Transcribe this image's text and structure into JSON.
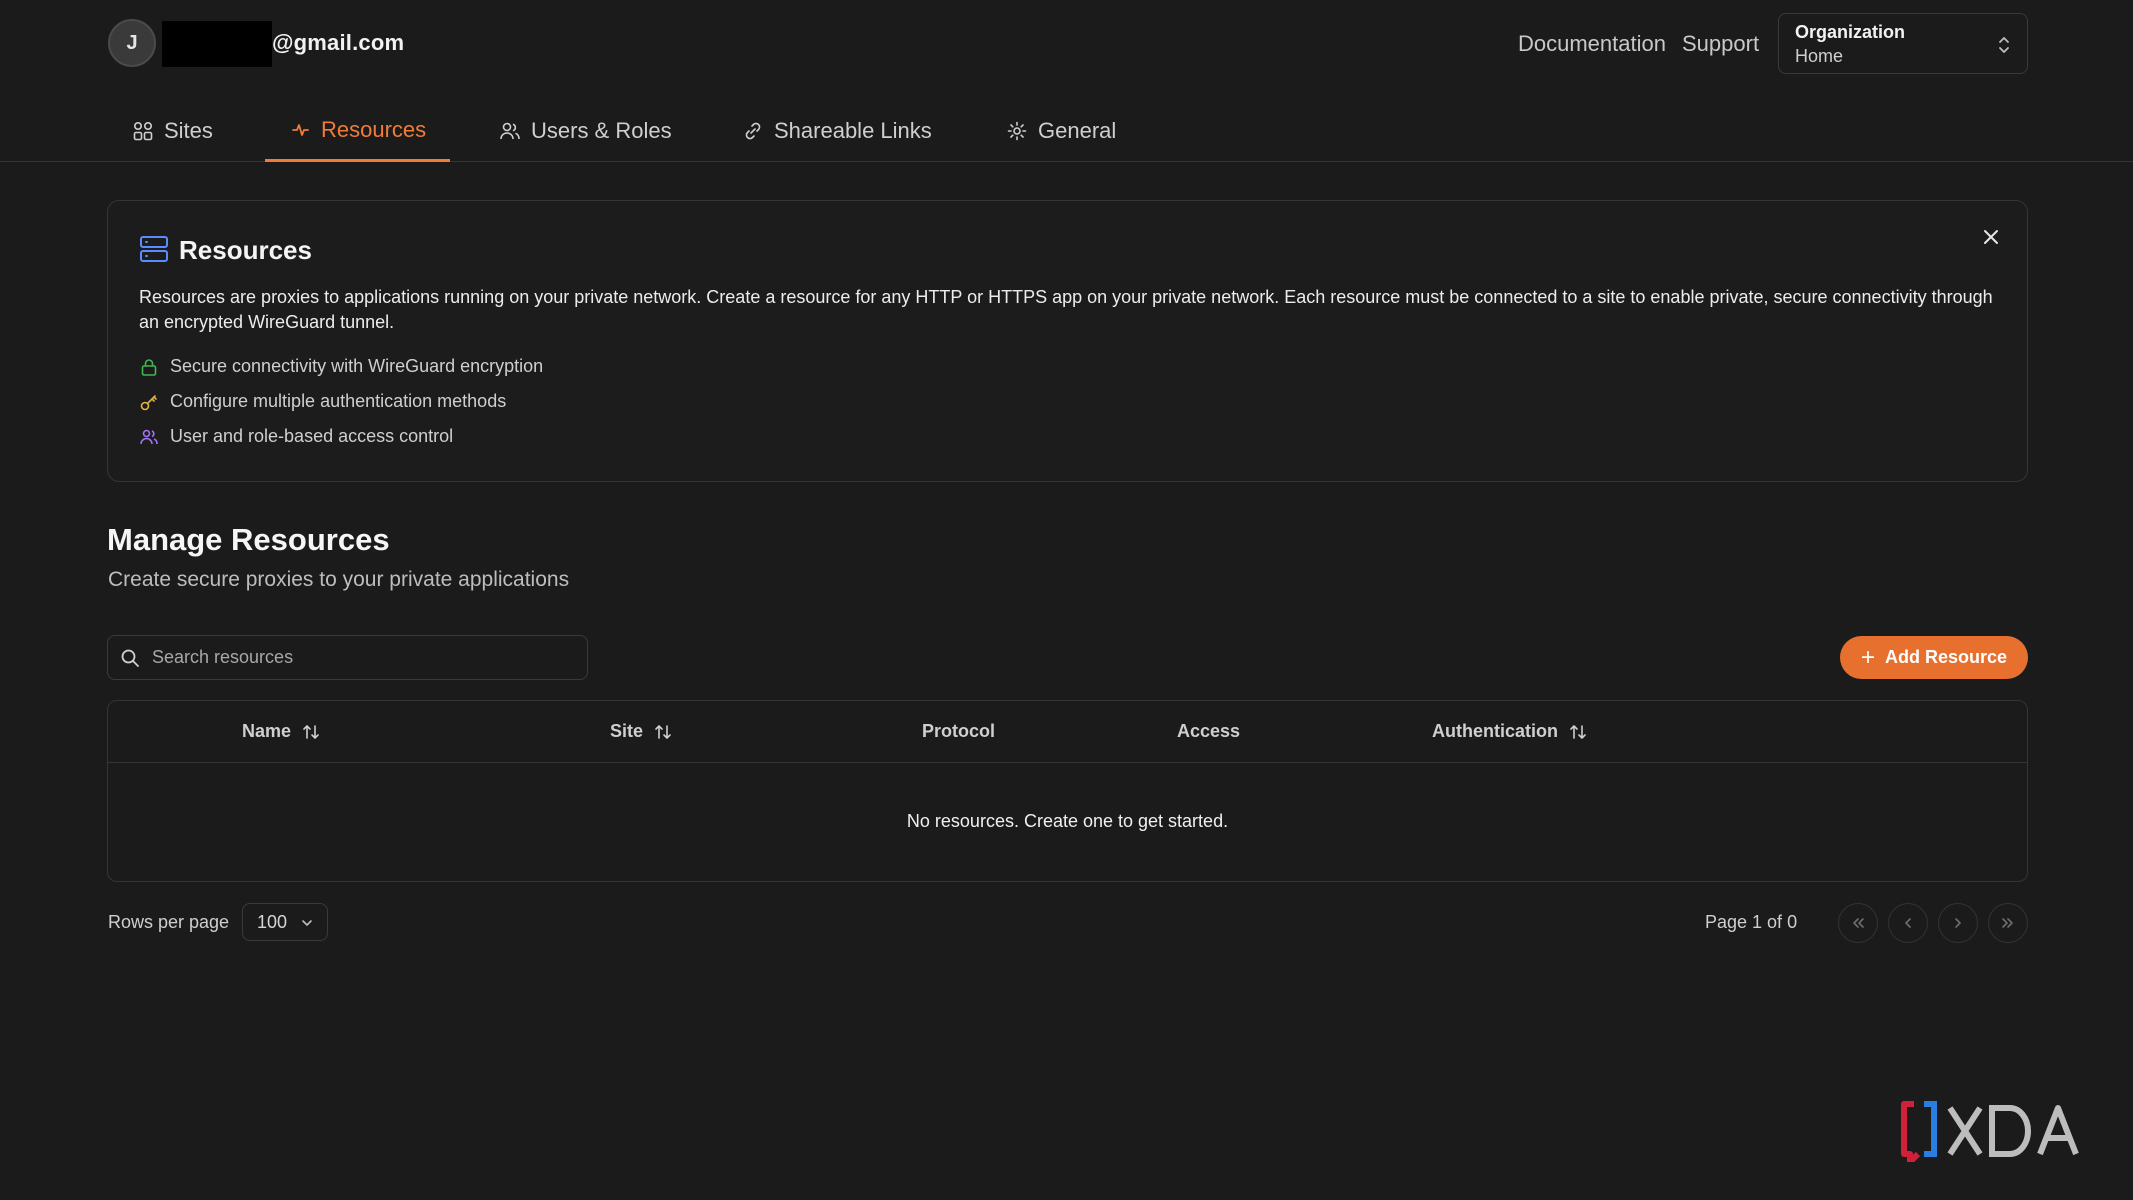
{
  "header": {
    "avatar_initial": "J",
    "email": "@gmail.com",
    "links": {
      "documentation": "Documentation",
      "support": "Support"
    },
    "org_selector": {
      "label": "Organization",
      "value": "Home"
    }
  },
  "tabs": [
    {
      "label": "Sites",
      "icon": "sites-icon",
      "active": false
    },
    {
      "label": "Resources",
      "icon": "resources-icon",
      "active": true
    },
    {
      "label": "Users & Roles",
      "icon": "users-icon",
      "active": false
    },
    {
      "label": "Shareable Links",
      "icon": "link-icon",
      "active": false
    },
    {
      "label": "General",
      "icon": "gear-icon",
      "active": false
    }
  ],
  "info_card": {
    "title": "Resources",
    "description": "Resources are proxies to applications running on your private network. Create a resource for any HTTP or HTTPS app on your private network. Each resource must be connected to a site to enable private, secure connectivity through an encrypted WireGuard tunnel.",
    "features": [
      {
        "text": "Secure connectivity with WireGuard encryption",
        "icon": "lock-icon",
        "color": "#3fb950"
      },
      {
        "text": "Configure multiple authentication methods",
        "icon": "key-icon",
        "color": "#e3b341"
      },
      {
        "text": "User and role-based access control",
        "icon": "users-icon",
        "color": "#a371f7"
      }
    ]
  },
  "manage": {
    "title": "Manage Resources",
    "subtitle": "Create secure proxies to your private applications",
    "search_placeholder": "Search resources",
    "add_button": "Add Resource"
  },
  "table": {
    "columns": [
      {
        "label": "Name",
        "sortable": true
      },
      {
        "label": "Site",
        "sortable": true
      },
      {
        "label": "Protocol",
        "sortable": false
      },
      {
        "label": "Access",
        "sortable": false
      },
      {
        "label": "Authentication",
        "sortable": true
      }
    ],
    "rows": [],
    "empty_message": "No resources. Create one to get started."
  },
  "pagination": {
    "rows_per_page_label": "Rows per page",
    "rows_per_page": "100",
    "page_info": "Page 1 of 0"
  },
  "theme": {
    "accent": "#e8702f",
    "background": "#1b1b1b",
    "border": "#353535"
  },
  "watermark": {
    "text": "XDA"
  }
}
